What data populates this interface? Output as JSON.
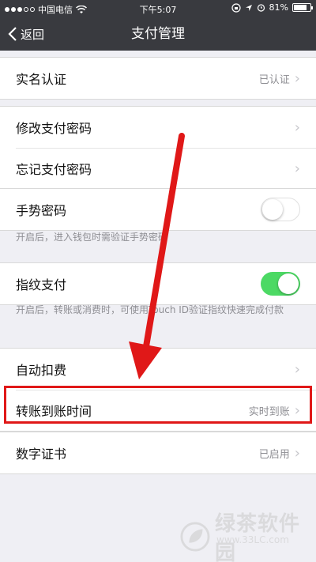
{
  "status_bar": {
    "carrier": "中国电信",
    "time": "下午5:07",
    "battery": "81%",
    "battery_level": 0.81
  },
  "nav": {
    "back_label": "返回",
    "title": "支付管理"
  },
  "rows": {
    "real_name": {
      "label": "实名认证",
      "value": "已认证"
    },
    "change_password": {
      "label": "修改支付密码"
    },
    "forgot_password": {
      "label": "忘记支付密码"
    },
    "gesture_password": {
      "label": "手势密码",
      "enabled": false
    },
    "gesture_note": "开启后，进入钱包时需验证手势密码",
    "fingerprint_pay": {
      "label": "指纹支付",
      "enabled": true
    },
    "fingerprint_note": "开启后，转账或消费时，可使用Touch ID验证指纹快速完成付款",
    "auto_deduct": {
      "label": "自动扣费"
    },
    "transfer_time": {
      "label": "转账到账时间",
      "value": "实时到账"
    },
    "digital_cert": {
      "label": "数字证书",
      "value": "已启用"
    }
  },
  "colors": {
    "nav_bg": "#393a3f",
    "switch_on": "#4cd964",
    "annotation_red": "#e01818"
  },
  "watermark": {
    "text": "绿茶软件园",
    "url": "www.33LC.com"
  }
}
